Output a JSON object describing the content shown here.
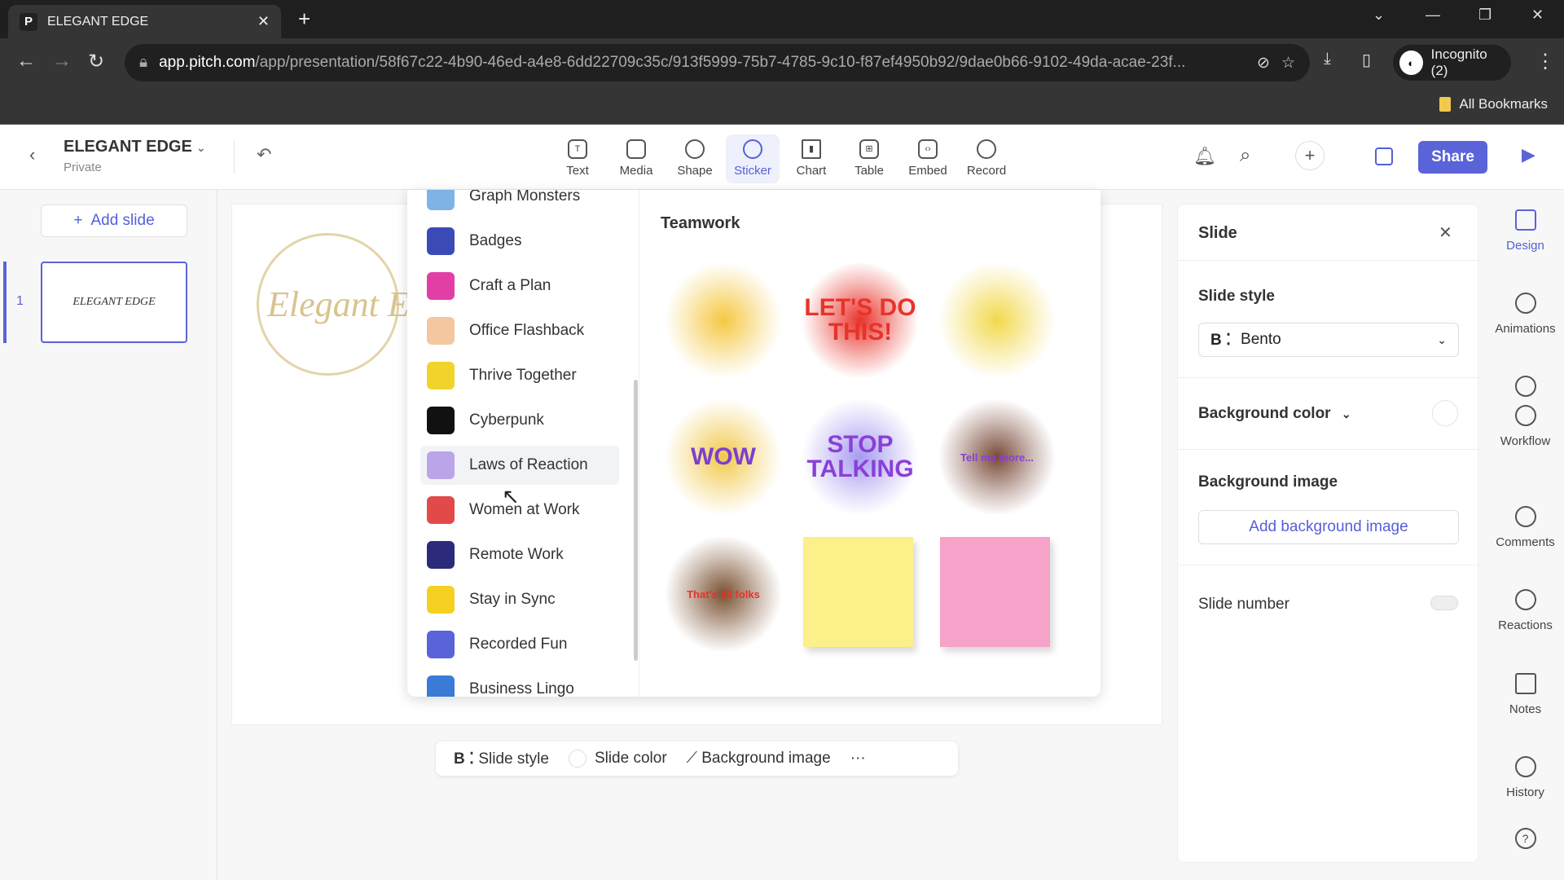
{
  "browser": {
    "tab_title": "ELEGANT EDGE",
    "url_host": "app.pitch.com",
    "url_path": "/app/presentation/58f67c22-4b90-46ed-a4e8-6dd22709c35c/913f5999-75b7-4785-9c10-f87ef4950b92/9dae0b66-9102-49da-acae-23f...",
    "profile": "Incognito (2)",
    "bookmarks": "All Bookmarks"
  },
  "doc": {
    "title": "ELEGANT EDGE",
    "visibility": "Private"
  },
  "toolbar": {
    "tools": [
      "Text",
      "Media",
      "Shape",
      "Sticker",
      "Chart",
      "Table",
      "Embed",
      "Record"
    ],
    "share": "Share"
  },
  "slides": {
    "add": "Add slide",
    "number": "1",
    "thumb_text": "ELEGANT EDGE"
  },
  "canvas": {
    "logo_text": "Elegant Ed"
  },
  "stickers": {
    "categories": [
      "Graph Monsters",
      "Badges",
      "Craft a Plan",
      "Office Flashback",
      "Thrive Together",
      "Cyberpunk",
      "Laws of Reaction",
      "Women at Work",
      "Remote Work",
      "Stay in Sync",
      "Recorded Fun",
      "Business Lingo"
    ],
    "category_colors": [
      "#7fb3e8",
      "#3b4bb5",
      "#e23fa6",
      "#f4c7a0",
      "#f2d32b",
      "#111111",
      "#b9a5e8",
      "#e24a4a",
      "#2c2a7a",
      "#f5d020",
      "#5a63d8",
      "#3a7bd5"
    ],
    "section": "Teamwork",
    "items": [
      "",
      "LET'S DO THIS!",
      "",
      "WOW",
      "STOP TALKING",
      "Tell me more...",
      "That's all folks",
      "",
      ""
    ]
  },
  "panel": {
    "title": "Slide",
    "slide_style_label": "Slide style",
    "style_value": "Bento",
    "bg_color": "Background color",
    "bg_image": "Background image",
    "add_bg": "Add background image",
    "slide_number": "Slide number"
  },
  "rail": [
    "Design",
    "Animations",
    "Workflow",
    "Comments",
    "Reactions",
    "Notes",
    "History"
  ],
  "bottom": {
    "style": "Slide style",
    "color": "Slide color",
    "bg": "Background image",
    "more": "···"
  },
  "accent": "#5a63d8"
}
